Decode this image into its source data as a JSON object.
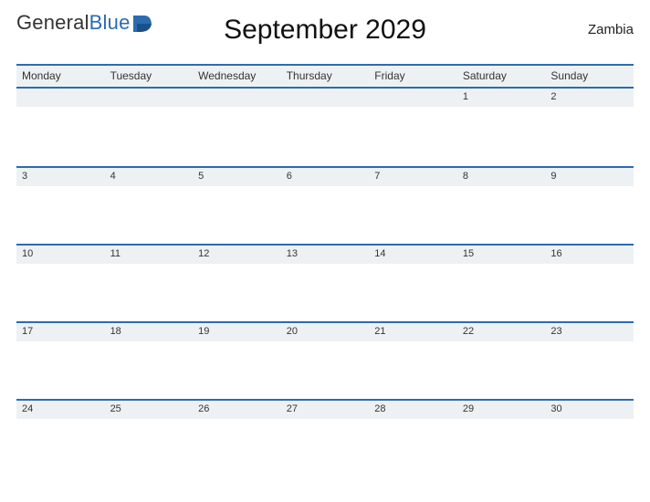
{
  "brand": {
    "name_part1": "General",
    "name_part2": "Blue",
    "accent": "#2b6cb0"
  },
  "title": "September 2029",
  "country": "Zambia",
  "days_of_week": [
    "Monday",
    "Tuesday",
    "Wednesday",
    "Thursday",
    "Friday",
    "Saturday",
    "Sunday"
  ],
  "weeks": [
    [
      "",
      "",
      "",
      "",
      "",
      "1",
      "2"
    ],
    [
      "3",
      "4",
      "5",
      "6",
      "7",
      "8",
      "9"
    ],
    [
      "10",
      "11",
      "12",
      "13",
      "14",
      "15",
      "16"
    ],
    [
      "17",
      "18",
      "19",
      "20",
      "21",
      "22",
      "23"
    ],
    [
      "24",
      "25",
      "26",
      "27",
      "28",
      "29",
      "30"
    ]
  ],
  "chart_data": {
    "type": "table",
    "title": "September 2029 — Zambia",
    "columns": [
      "Monday",
      "Tuesday",
      "Wednesday",
      "Thursday",
      "Friday",
      "Saturday",
      "Sunday"
    ],
    "rows": [
      [
        "",
        "",
        "",
        "",
        "",
        "1",
        "2"
      ],
      [
        "3",
        "4",
        "5",
        "6",
        "7",
        "8",
        "9"
      ],
      [
        "10",
        "11",
        "12",
        "13",
        "14",
        "15",
        "16"
      ],
      [
        "17",
        "18",
        "19",
        "20",
        "21",
        "22",
        "23"
      ],
      [
        "24",
        "25",
        "26",
        "27",
        "28",
        "29",
        "30"
      ]
    ]
  }
}
